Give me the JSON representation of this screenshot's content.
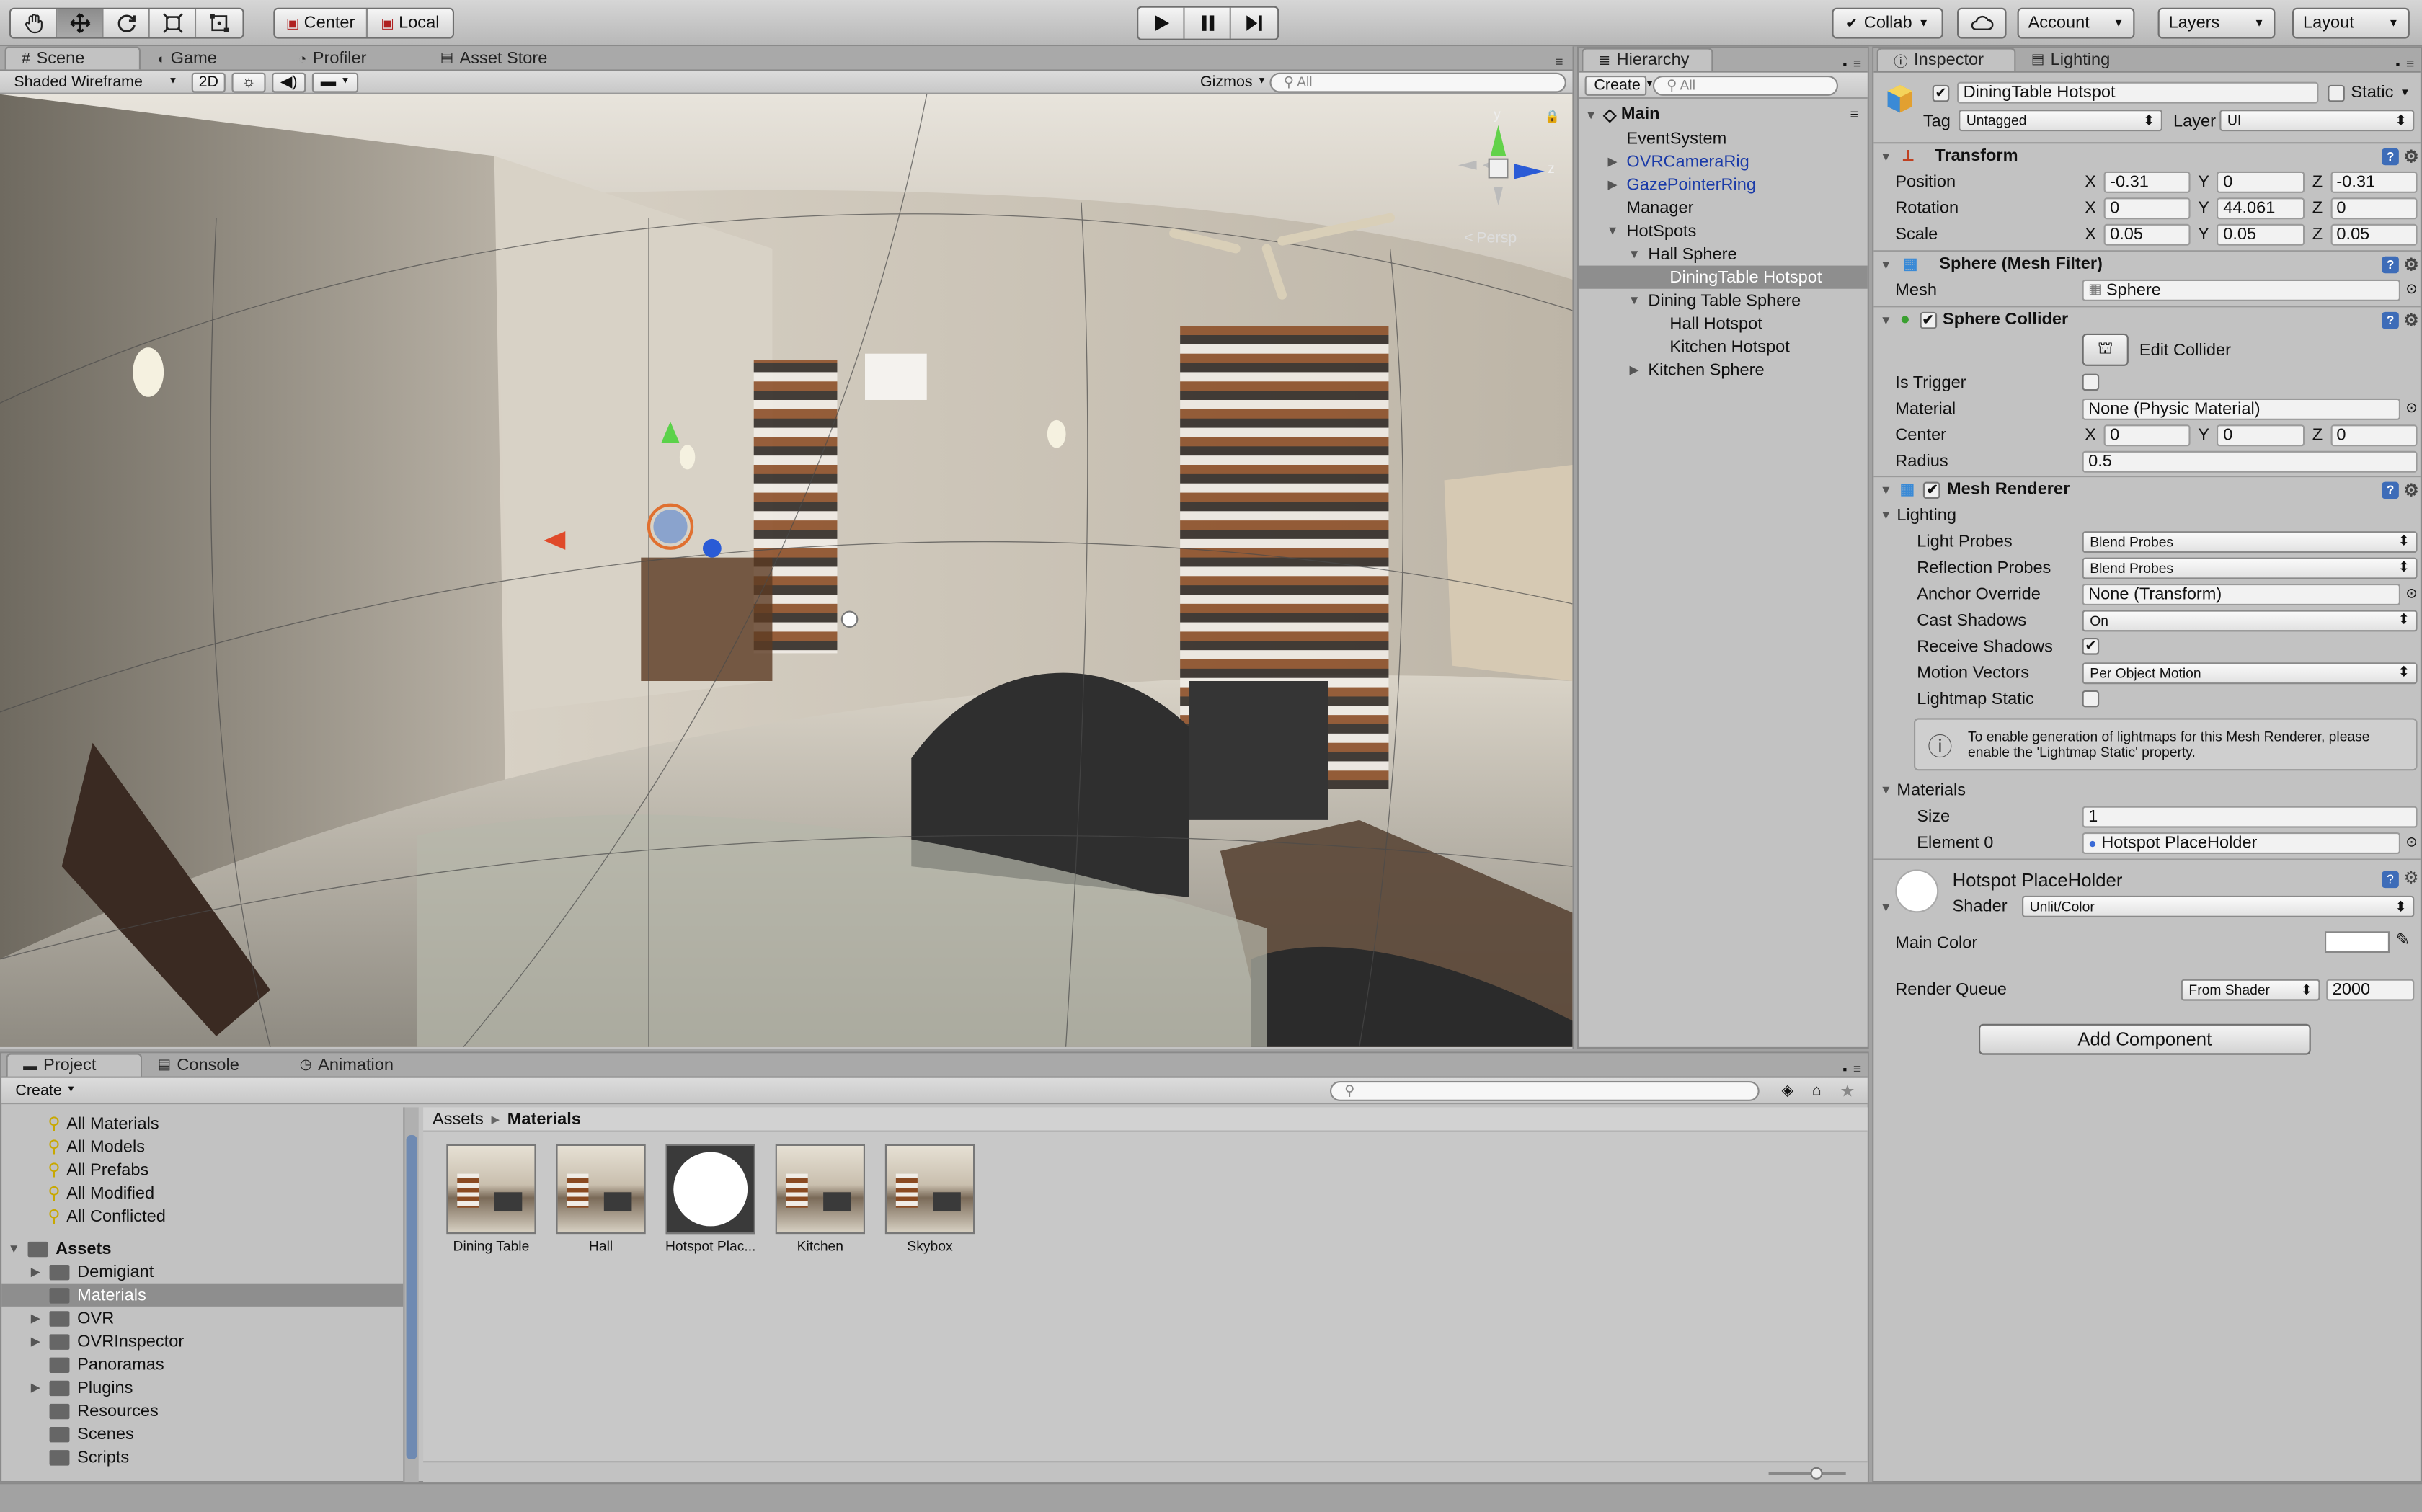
{
  "toolbar": {
    "tools": [
      "hand-tool",
      "move-tool",
      "rotate-tool",
      "scale-tool",
      "rect-tool"
    ],
    "pivot_center": "Center",
    "pivot_local": "Local",
    "collab": "Collab",
    "account": "Account",
    "layers": "Layers",
    "layout": "Layout"
  },
  "scene_tabs": {
    "scene": "Scene",
    "game": "Game",
    "profiler": "Profiler",
    "asset_store": "Asset Store"
  },
  "scene_toolbar": {
    "draw_mode": "Shaded Wireframe",
    "mode_2d": "2D",
    "gizmos": "Gizmos",
    "search_placeholder": "All"
  },
  "scene_view": {
    "gizmo_x": "x",
    "gizmo_y": "y",
    "gizmo_z": "z",
    "projection": "Persp"
  },
  "hierarchy": {
    "tab": "Hierarchy",
    "create": "Create",
    "search_placeholder": "All",
    "scene_name": "Main",
    "items": [
      {
        "label": "EventSystem",
        "depth": 1,
        "arrow": "",
        "prefab": false,
        "selected": false
      },
      {
        "label": "OVRCameraRig",
        "depth": 1,
        "arrow": "▶",
        "prefab": true,
        "selected": false
      },
      {
        "label": "GazePointerRing",
        "depth": 1,
        "arrow": "▶",
        "prefab": true,
        "selected": false
      },
      {
        "label": "Manager",
        "depth": 1,
        "arrow": "",
        "prefab": false,
        "selected": false
      },
      {
        "label": "HotSpots",
        "depth": 1,
        "arrow": "▼",
        "prefab": false,
        "selected": false
      },
      {
        "label": "Hall Sphere",
        "depth": 2,
        "arrow": "▼",
        "prefab": false,
        "selected": false
      },
      {
        "label": "DiningTable Hotspot",
        "depth": 3,
        "arrow": "",
        "prefab": false,
        "selected": true
      },
      {
        "label": "Dining Table Sphere",
        "depth": 2,
        "arrow": "▼",
        "prefab": false,
        "selected": false
      },
      {
        "label": "Hall Hotspot",
        "depth": 3,
        "arrow": "",
        "prefab": false,
        "selected": false
      },
      {
        "label": "Kitchen Hotspot",
        "depth": 3,
        "arrow": "",
        "prefab": false,
        "selected": false
      },
      {
        "label": "Kitchen Sphere",
        "depth": 2,
        "arrow": "▶",
        "prefab": false,
        "selected": false
      }
    ]
  },
  "inspector": {
    "tab": "Inspector",
    "lighting_tab": "Lighting",
    "object_name": "DiningTable Hotspot",
    "static_label": "Static",
    "tag_label": "Tag",
    "tag_value": "Untagged",
    "layer_label": "Layer",
    "layer_value": "UI",
    "transform": {
      "title": "Transform",
      "position_label": "Position",
      "rotation_label": "Rotation",
      "scale_label": "Scale",
      "position": [
        "-0.31",
        "0",
        "-0.31"
      ],
      "rotation": [
        "0",
        "44.061",
        "0"
      ],
      "scale": [
        "0.05",
        "0.05",
        "0.05"
      ]
    },
    "mesh_filter": {
      "title": "Sphere (Mesh Filter)",
      "mesh_label": "Mesh",
      "mesh_value": "Sphere"
    },
    "sphere_collider": {
      "title": "Sphere Collider",
      "edit_collider": "Edit Collider",
      "is_trigger_label": "Is Trigger",
      "material_label": "Material",
      "material_value": "None (Physic Material)",
      "center_label": "Center",
      "center": [
        "0",
        "0",
        "0"
      ],
      "radius_label": "Radius",
      "radius_value": "0.5"
    },
    "mesh_renderer": {
      "title": "Mesh Renderer",
      "lighting_label": "Lighting",
      "light_probes_label": "Light Probes",
      "light_probes_value": "Blend Probes",
      "reflection_probes_label": "Reflection Probes",
      "reflection_probes_value": "Blend Probes",
      "anchor_override_label": "Anchor Override",
      "anchor_override_value": "None (Transform)",
      "cast_shadows_label": "Cast Shadows",
      "cast_shadows_value": "On",
      "receive_shadows_label": "Receive Shadows",
      "motion_vectors_label": "Motion Vectors",
      "motion_vectors_value": "Per Object Motion",
      "lightmap_static_label": "Lightmap Static",
      "info_text": "To enable generation of lightmaps for this Mesh Renderer, please enable the 'Lightmap Static' property.",
      "materials_label": "Materials",
      "size_label": "Size",
      "size_value": "1",
      "element0_label": "Element 0",
      "element0_value": "Hotspot PlaceHolder"
    },
    "material": {
      "title": "Hotspot PlaceHolder",
      "shader_label": "Shader",
      "shader_value": "Unlit/Color",
      "main_color_label": "Main Color",
      "main_color": "#ffffff",
      "render_queue_label": "Render Queue",
      "render_queue_mode": "From Shader",
      "render_queue_value": "2000"
    },
    "add_component": "Add Component"
  },
  "project": {
    "tabs": {
      "project": "Project",
      "console": "Console",
      "animation": "Animation"
    },
    "create": "Create",
    "favorites": [
      "All Materials",
      "All Models",
      "All Prefabs",
      "All Modified",
      "All Conflicted"
    ],
    "assets_root": "Assets",
    "folders": [
      {
        "label": "Demigiant",
        "arrow": "▶",
        "selected": false
      },
      {
        "label": "Materials",
        "arrow": "",
        "selected": true
      },
      {
        "label": "OVR",
        "arrow": "▶",
        "selected": false
      },
      {
        "label": "OVRInspector",
        "arrow": "▶",
        "selected": false
      },
      {
        "label": "Panoramas",
        "arrow": "",
        "selected": false
      },
      {
        "label": "Plugins",
        "arrow": "▶",
        "selected": false
      },
      {
        "label": "Resources",
        "arrow": "",
        "selected": false
      },
      {
        "label": "Scenes",
        "arrow": "",
        "selected": false
      },
      {
        "label": "Scripts",
        "arrow": "",
        "selected": false
      }
    ],
    "breadcrumb": [
      "Assets",
      "Materials"
    ],
    "assets": [
      {
        "label": "Dining Table",
        "kind": "pano"
      },
      {
        "label": "Hall",
        "kind": "pano"
      },
      {
        "label": "Hotspot Plac...",
        "kind": "sphere"
      },
      {
        "label": "Kitchen",
        "kind": "pano"
      },
      {
        "label": "Skybox",
        "kind": "pano"
      }
    ]
  }
}
